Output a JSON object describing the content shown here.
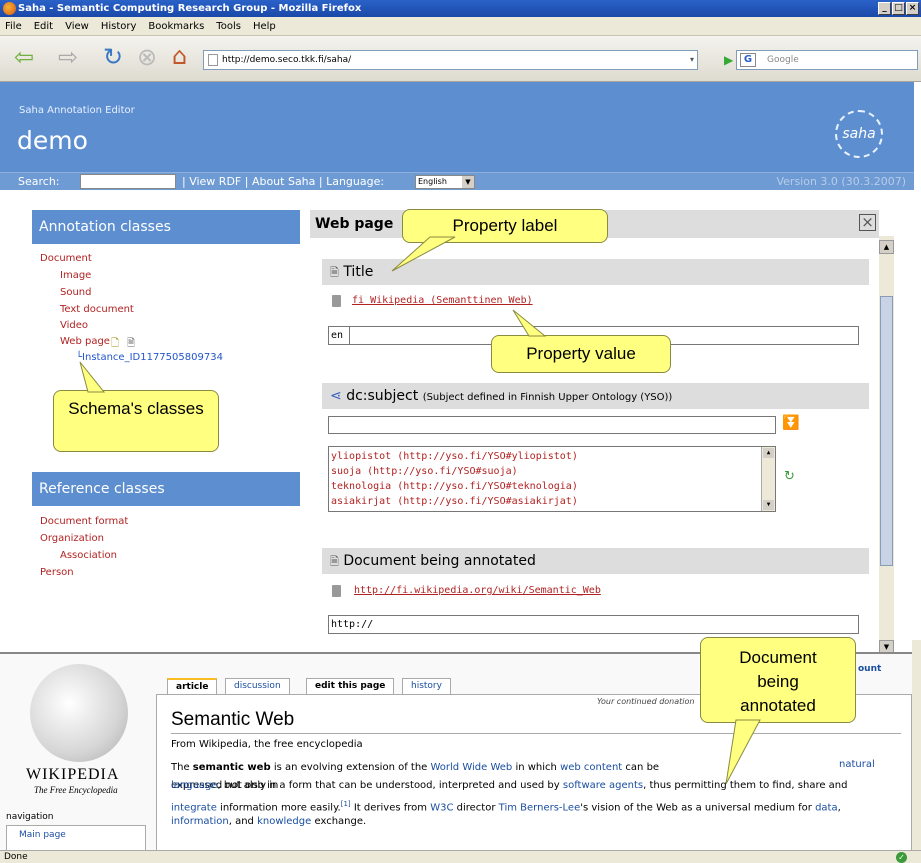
{
  "window": {
    "title": "Saha - Semantic Computing Research Group - Mozilla Firefox",
    "controls": [
      "_",
      "□",
      "×"
    ]
  },
  "menu": [
    "File",
    "Edit",
    "View",
    "History",
    "Bookmarks",
    "Tools",
    "Help"
  ],
  "browser": {
    "url": "http://demo.seco.tkk.fi/saha/",
    "search_placeholder": "Google"
  },
  "saha": {
    "subtitle": "Saha Annotation Editor",
    "project": "demo",
    "logo_text": "saha",
    "search_label": "Search:",
    "links": "| View RDF | About Saha | Language:",
    "language": "English",
    "version": "Version 3.0 (30.3.2007)"
  },
  "left": {
    "annotation_title": "Annotation classes",
    "classes": [
      "Document",
      "Image",
      "Sound",
      "Text document",
      "Video",
      "Web page"
    ],
    "instance": "Instance_ID1177505809734",
    "reference_title": "Reference classes",
    "ref_classes": [
      "Document format",
      "Organization",
      "Association",
      "Person"
    ]
  },
  "main": {
    "header": "Web page",
    "title_label": "Title",
    "title_lang": "fi",
    "title_value": "Wikipedia (Semanttinen Web)",
    "title_new_lang": "en",
    "subject_label": "dc:subject",
    "subject_desc": "(Subject defined in Finnish Upper Ontology (YSO))",
    "subjects": [
      "yliopistot (http://yso.fi/YSO#yliopistot)",
      "suoja (http://yso.fi/YSO#suoja)",
      "teknologia (http://yso.fi/YSO#teknologia)",
      "asiakirjat (http://yso.fi/YSO#asiakirjat)"
    ],
    "doc_label": "Document being annotated",
    "doc_value": "http://fi.wikipedia.org/wiki/Semantic_Web",
    "doc_input": "http://"
  },
  "callouts": {
    "property_label": "Property label",
    "property_value": "Property value",
    "schema": "Schema's classes",
    "document": "Document being annotated"
  },
  "wiki": {
    "tabs": [
      "article",
      "discussion",
      "edit this page",
      "history"
    ],
    "logo_word": "WIKIPEDIA",
    "logo_tagline": "The Free Encyclopedia",
    "heading": "Semantic Web",
    "from": "From Wikipedia, the free encyclopedia",
    "notice": "Your continued donation",
    "account": "ount",
    "nav_title": "navigation",
    "nav_item": "Main page",
    "para1_a": "The",
    "para1_bold": "semantic web",
    "para1_b": "is an evolving extension of the",
    "link_www": "World Wide Web",
    "para1_c": "in which",
    "link_wc": "web content",
    "para1_d": "can be expressed not only in",
    "link_nl": "natural",
    "line2_a": "language",
    "line2_b": ", but also in a form that can be understood, interpreted and used by",
    "link_sa": "software agents",
    "line2_c": ", thus permitting them to find, share and",
    "line3_link": "integrate",
    "line3_a": "information more easily.",
    "line3_sup": "[1]",
    "line3_b": "It derives from",
    "link_w3c": "W3C",
    "line3_c": "director",
    "link_tbl": "Tim Berners-Lee",
    "line3_d": "'s vision of the Web as a universal medium for",
    "link_data": "data",
    "line4_link": "information",
    "line4_a": ", and",
    "line4_link2": "knowledge",
    "line4_b": "exchange."
  },
  "status": "Done"
}
